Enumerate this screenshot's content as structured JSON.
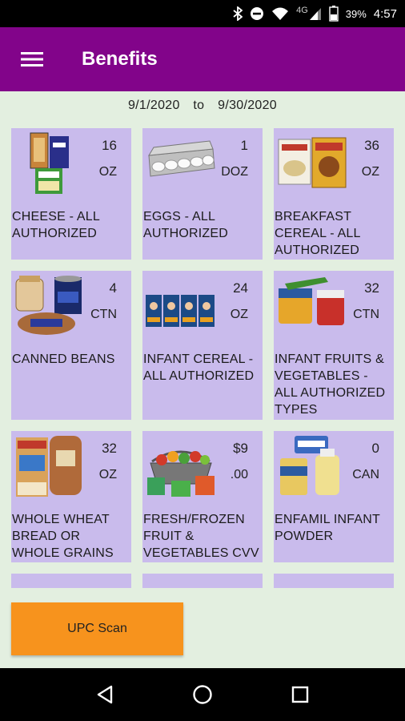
{
  "status_bar": {
    "network": "4G",
    "battery": "39%",
    "time": "4:57",
    "icons": [
      "bluetooth-icon",
      "do-not-disturb-icon",
      "wifi-icon",
      "signal-icon",
      "battery-icon"
    ]
  },
  "app_bar": {
    "title": "Benefits",
    "menu_icon": "hamburger-menu-icon",
    "color": "#82048a"
  },
  "period": {
    "start": "9/1/2020",
    "to": "to",
    "end": "9/30/2020"
  },
  "benefits": [
    {
      "qty": "16",
      "unit": "OZ",
      "label": "CHEESE - ALL AUTHORIZED",
      "icon": "cheese-icon"
    },
    {
      "qty": "1",
      "unit": "DOZ",
      "label": "EGGS - ALL AUTHORIZED",
      "icon": "eggs-icon"
    },
    {
      "qty": "36",
      "unit": "OZ",
      "label": "BREAKFAST CEREAL - ALL AUTHORIZED",
      "icon": "cereal-icon"
    },
    {
      "qty": "4",
      "unit": "CTN",
      "label": "CANNED BEANS",
      "icon": "beans-icon"
    },
    {
      "qty": "24",
      "unit": "OZ",
      "label": "INFANT CEREAL - ALL AUTHORIZED",
      "icon": "infant-cereal-icon"
    },
    {
      "qty": "32",
      "unit": "CTN",
      "label": "INFANT FRUITS & VEGETABLES - ALL AUTHORIZED TYPES",
      "icon": "baby-food-icon"
    },
    {
      "qty": "32",
      "unit": "OZ",
      "label": "WHOLE WHEAT BREAD OR WHOLE GRAINS",
      "icon": "bread-icon"
    },
    {
      "qty": "$9",
      "unit": ".00",
      "label": "FRESH/FROZEN FRUIT & VEGETABLES CVV",
      "icon": "produce-basket-icon"
    },
    {
      "qty": "0",
      "unit": "CAN",
      "label": "ENFAMIL INFANT POWDER",
      "icon": "formula-icon"
    }
  ],
  "actions": {
    "upc_scan": "UPC Scan"
  },
  "colors": {
    "tile": "#c9bbec",
    "background": "#e3efe0",
    "accent": "#f7931d"
  }
}
